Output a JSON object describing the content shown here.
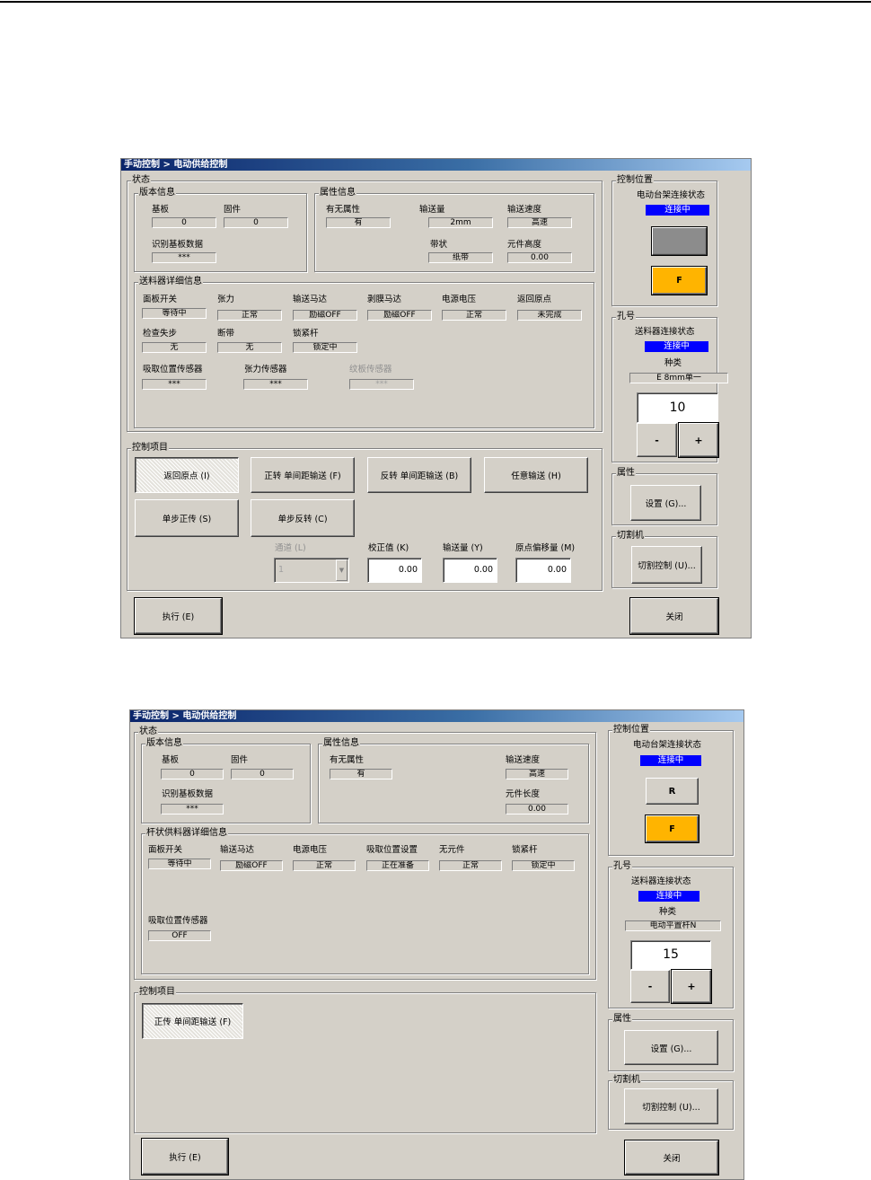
{
  "win1": {
    "title": "手动控制 > 电动供给控制",
    "status": {
      "legend": "状态",
      "basic": {
        "legend": "版本信息",
        "substrate_label": "基板",
        "substrate_value": "0",
        "firmware_label": "固件",
        "firmware_value": "0",
        "board_id_label": "识别基板数据",
        "board_id_value": "***"
      },
      "attr": {
        "legend": "属性信息",
        "presence_label": "有无属性",
        "presence_value": "有",
        "feed_amount_label": "输送量",
        "feed_amount_value": "2mm",
        "feed_speed_label": "输送速度",
        "feed_speed_value": "高速",
        "tape_label": "带状",
        "tape_value": "纸带",
        "part_height_label": "元件高度",
        "part_height_value": "0.00"
      },
      "feeder": {
        "legend": "送料器详细信息",
        "row1": [
          {
            "label": "面板开关",
            "value": "等待中"
          },
          {
            "label": "张力",
            "value": "正常"
          },
          {
            "label": "输送马达",
            "value": "励磁OFF"
          },
          {
            "label": "剥膜马达",
            "value": "励磁OFF"
          },
          {
            "label": "电源电压",
            "value": "正常"
          },
          {
            "label": "返回原点",
            "value": "未完成"
          }
        ],
        "row2": [
          {
            "label": "检查失步",
            "value": "无"
          },
          {
            "label": "断带",
            "value": "无"
          },
          {
            "label": "锁紧杆",
            "value": "锁定中"
          }
        ],
        "row3": [
          {
            "label": "吸取位置传感器",
            "value": "***"
          },
          {
            "label": "张力传感器",
            "value": "***"
          },
          {
            "label": "纹板传感器",
            "value": "***"
          }
        ]
      }
    },
    "control": {
      "legend": "控制项目",
      "btn_home": "返回原点 (I)",
      "btn_forward": "正转 单间距输送 (F)",
      "btn_reverse": "反转 单间距输送 (B)",
      "btn_any": "任意输送 (H)",
      "btn_step_fwd": "单步正传 (S)",
      "btn_step_rev": "单步反转 (C)",
      "channel_label": "通道 (L)",
      "channel_value": "1",
      "correction_label": "校正值 (K)",
      "correction_value": "0.00",
      "feed_label": "输送量 (Y)",
      "feed_value": "0.00",
      "origin_label": "原点偏移量 (M)",
      "origin_value": "0.00"
    },
    "ctrlpos": {
      "legend": "控制位置",
      "conn_label": "电动台架连接状态",
      "conn_value": "连接中",
      "btn_f": "F"
    },
    "hole": {
      "legend": "孔号",
      "conn_label": "送料器连接状态",
      "conn_value": "连接中",
      "type_label": "种类",
      "type_value": "E 8mm单一",
      "number": "10",
      "minus": "-",
      "plus": "+"
    },
    "props": {
      "legend": "属性",
      "btn": "设置 (G)..."
    },
    "cutter": {
      "legend": "切割机",
      "btn": "切割控制 (U)..."
    },
    "execute": "执行 (E)",
    "close": "关闭"
  },
  "win2": {
    "title": "手动控制 > 电动供给控制",
    "status": {
      "legend": "状态",
      "basic": {
        "legend": "版本信息",
        "substrate_label": "基板",
        "substrate_value": "0",
        "firmware_label": "固件",
        "firmware_value": "0",
        "board_id_label": "识别基板数据",
        "board_id_value": "***"
      },
      "attr": {
        "legend": "属性信息",
        "presence_label": "有无属性",
        "presence_value": "有",
        "feed_speed_label": "输送速度",
        "feed_speed_value": "高速",
        "part_length_label": "元件长度",
        "part_length_value": "0.00"
      },
      "feeder": {
        "legend": "杆状供料器详细信息",
        "row1": [
          {
            "label": "面板开关",
            "value": "等待中"
          },
          {
            "label": "输送马达",
            "value": "励磁OFF"
          },
          {
            "label": "电源电压",
            "value": "正常"
          },
          {
            "label": "吸取位置设置",
            "value": "正在准备"
          },
          {
            "label": "无元件",
            "value": "正常"
          },
          {
            "label": "锁紧杆",
            "value": "锁定中"
          }
        ],
        "sensor_label": "吸取位置传感器",
        "sensor_value": "OFF"
      }
    },
    "control": {
      "legend": "控制项目",
      "btn_forward": "正传 单间距输送 (F)"
    },
    "ctrlpos": {
      "legend": "控制位置",
      "conn_label": "电动台架连接状态",
      "conn_value": "连接中",
      "btn_r": "R",
      "btn_f": "F"
    },
    "hole": {
      "legend": "孔号",
      "conn_label": "送料器连接状态",
      "conn_value": "连接中",
      "type_label": "种类",
      "type_value": "电动平置杆N",
      "number": "15",
      "minus": "-",
      "plus": "+"
    },
    "props": {
      "legend": "属性",
      "btn": "设置 (G)..."
    },
    "cutter": {
      "legend": "切割机",
      "btn": "切割控制 (U)..."
    },
    "execute": "执行 (E)",
    "close": "关闭"
  },
  "colors": {
    "face": "#d4d0c8",
    "title_start": "#0a246a",
    "title_end": "#a6caf0",
    "status_blue": "#0000ff",
    "f_button": "#ffb400"
  }
}
